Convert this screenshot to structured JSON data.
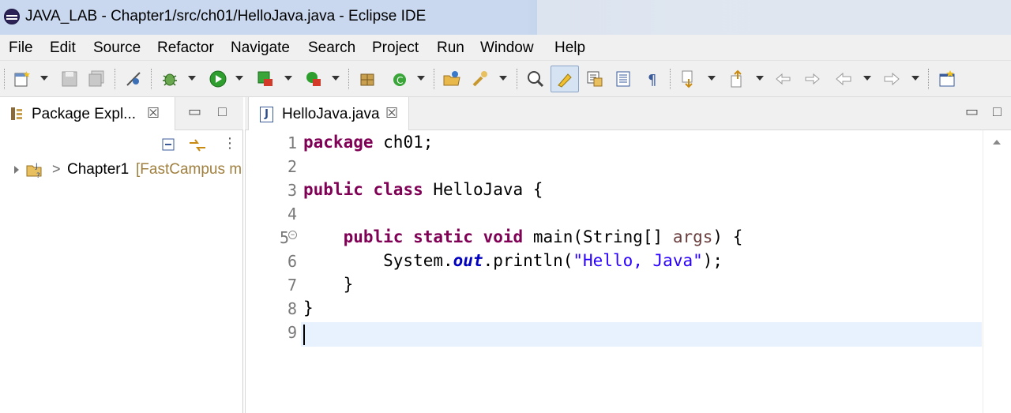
{
  "window": {
    "title": "JAVA_LAB - Chapter1/src/ch01/HelloJava.java - Eclipse IDE"
  },
  "menu": {
    "items": [
      "File",
      "Edit",
      "Source",
      "Refactor",
      "Navigate",
      "Search",
      "Project",
      "Run",
      "Window",
      "Help"
    ]
  },
  "toolbar": {
    "icons": [
      "new-icon",
      "save-icon",
      "save-all-icon",
      "skip-breakpoints-icon",
      "debug-icon",
      "run-icon",
      "coverage-icon",
      "run-external-tools-icon",
      "new-java-package-icon",
      "new-java-class-icon",
      "open-type-icon",
      "search-icon",
      "toggle-breadcrumb-icon",
      "mark-occurrences-icon",
      "block-selection-icon",
      "word-wrap-icon",
      "show-whitespace-icon",
      "next-annotation-icon",
      "previous-annotation-icon",
      "last-edit-location-icon",
      "back-icon",
      "forward-icon",
      "open-perspective-icon"
    ]
  },
  "package_explorer": {
    "tab_label": "Package Expl...",
    "project_name": "Chapter1",
    "project_extra": "[FastCampus m"
  },
  "editor": {
    "tab_label": "HelloJava.java",
    "line_numbers": [
      "1",
      "2",
      "3",
      "4",
      "5",
      "6",
      "7",
      "8",
      "9"
    ],
    "code": {
      "l1_kw": "package",
      "l1_rest": " ch01;",
      "l3_kw1": "public",
      "l3_kw2": "class",
      "l3_rest": " HelloJava {",
      "l5_indent": "    ",
      "l5_kw1": "public",
      "l5_kw2": "static",
      "l5_kw3": "void",
      "l5_mid": " main(String[] ",
      "l5_param": "args",
      "l5_end": ") {",
      "l6_pre": "        System.",
      "l6_field": "out",
      "l6_mid": ".println(",
      "l6_str": "\"Hello, Java\"",
      "l6_end": ");",
      "l7": "    }",
      "l8": "}"
    }
  }
}
